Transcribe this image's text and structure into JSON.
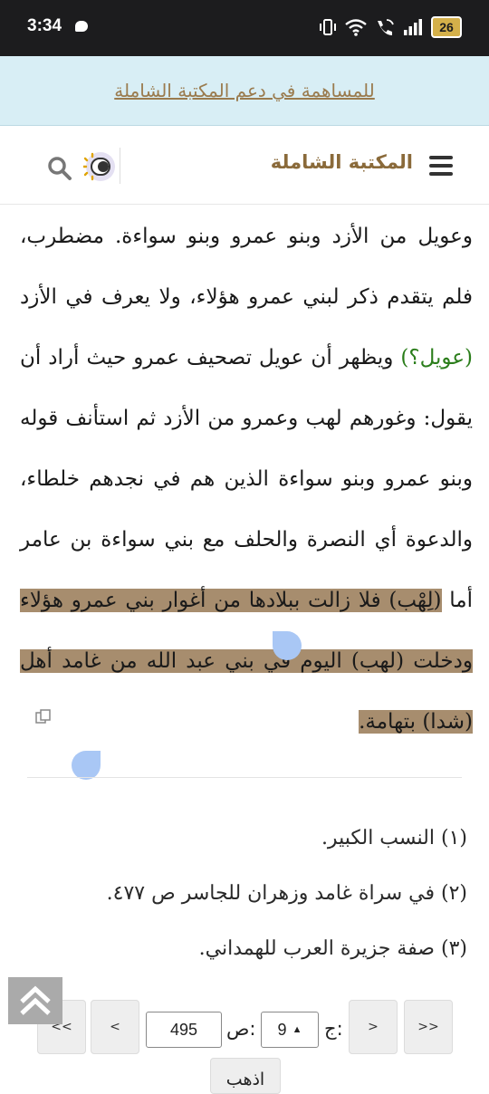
{
  "status_bar": {
    "time": "3:34",
    "battery": "26"
  },
  "banner": {
    "text": "للمساهمة في دعم المكتبة الشاملة"
  },
  "header": {
    "site_title": "المكتبة الشاملة"
  },
  "content": {
    "text_before": "وعويل من الأزد وبنو عمرو وبنو سواءة. مضطرب، فلم يتقدم ذكر لبني عمرو هؤلاء، ولا يعرف في الأزد ",
    "green_text": "(عويل؟)",
    "text_middle": " ويظهر أن عويل تصحيف عمرو حيث أراد أن يقول: وغورهم لهب وعمرو من الأزد ثم استأنف قوله وبنو عمرو وبنو سواءة الذين هم في نجدهم خلطاء، والدعوة أي النصرة والحلف مع بني سواءة بن عامر أما ",
    "highlighted_text": "(لِهْب) فلا زالت ببلادها من أغوار بني عمرو هؤلاء ودخلت (لهب) اليوم في بني عبد الله من غامد أهل (شدا) بتهامة."
  },
  "footnotes": [
    "(١) النسب الكبير.",
    "(٢) في سراة غامد وزهران للجاسر ص ٤٧٧.",
    "(٣) صفة جزيرة العرب للهمداني."
  ],
  "pager": {
    "first": "<<",
    "prev": "<",
    "page_label": "ص:",
    "page_value": "495",
    "part_label": "ج:",
    "part_value": "9",
    "next": ">",
    "last": ">>",
    "go": "اذهب"
  }
}
